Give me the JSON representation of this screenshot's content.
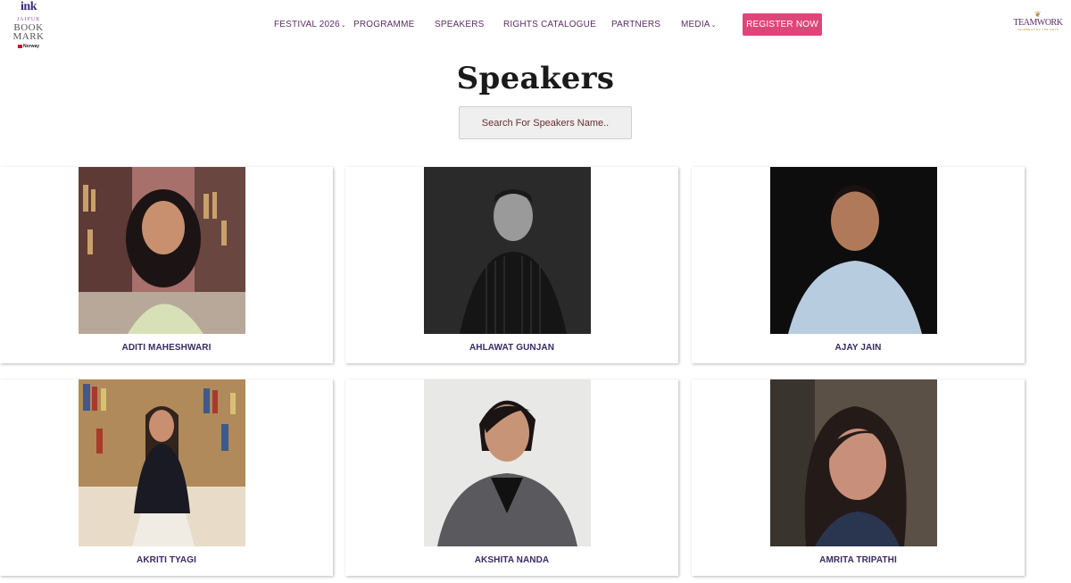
{
  "brand": {
    "left_logo": {
      "line1": "ink",
      "line2": "JAIPUR",
      "line3": "BOOK",
      "line4": "MARK",
      "line5": "Norway"
    },
    "right_logo": {
      "name": "TEAMWORK",
      "sub": "CELEBRATING THE ARTS"
    }
  },
  "nav": {
    "items": [
      {
        "label": "FESTIVAL 2026",
        "dropdown": true
      },
      {
        "label": "PROGRAMME",
        "dropdown": false
      },
      {
        "label": "SPEAKERS",
        "dropdown": false
      },
      {
        "label": "RIGHTS CATALOGUE",
        "dropdown": false
      },
      {
        "label": "PARTNERS",
        "dropdown": false
      },
      {
        "label": "MEDIA",
        "dropdown": true
      }
    ],
    "register_label": "REGISTER NOW",
    "accent_color": "#e0457a",
    "text_color": "#5a2d63"
  },
  "page": {
    "title": "Speakers",
    "search_placeholder": "Search For Speakers Name.."
  },
  "speakers": [
    {
      "name": "ADITI MAHESHWARI",
      "photo": "portrait-bookshelf-background"
    },
    {
      "name": "AHLAWAT GUNJAN",
      "photo": "portrait-monochrome"
    },
    {
      "name": "AJAY JAIN",
      "photo": "portrait-dark-background"
    },
    {
      "name": "AKRITI TYAGI",
      "photo": "portrait-bookshelf-background"
    },
    {
      "name": "AKSHITA NANDA",
      "photo": "portrait-light-background"
    },
    {
      "name": "AMRITA TRIPATHI",
      "photo": "portrait-dark-background"
    }
  ]
}
